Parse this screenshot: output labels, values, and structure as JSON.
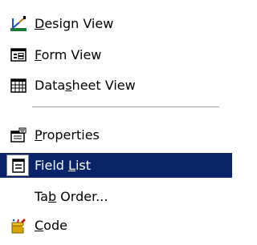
{
  "menu": {
    "items": [
      {
        "label_pre": "",
        "accel": "D",
        "label_post": "esign View",
        "icon": "design-view-icon"
      },
      {
        "label_pre": "",
        "accel": "F",
        "label_post": "orm View",
        "icon": "form-view-icon"
      },
      {
        "label_pre": "Data",
        "accel": "s",
        "label_post": "heet View",
        "icon": "datasheet-view-icon"
      },
      {
        "label_pre": "",
        "accel": "P",
        "label_post": "roperties",
        "icon": "properties-icon"
      },
      {
        "label_pre": "Field ",
        "accel": "L",
        "label_post": "ist",
        "icon": "field-list-icon",
        "selected": true
      },
      {
        "label_pre": "Ta",
        "accel": "b",
        "label_post": " Order...",
        "icon": ""
      },
      {
        "label_pre": "",
        "accel": "C",
        "label_post": "ode",
        "icon": "code-icon"
      }
    ]
  },
  "colors": {
    "highlight": "#0a246a",
    "highlight_text": "#ffffff",
    "text": "#000000",
    "menu_bg": "#ffffff"
  }
}
